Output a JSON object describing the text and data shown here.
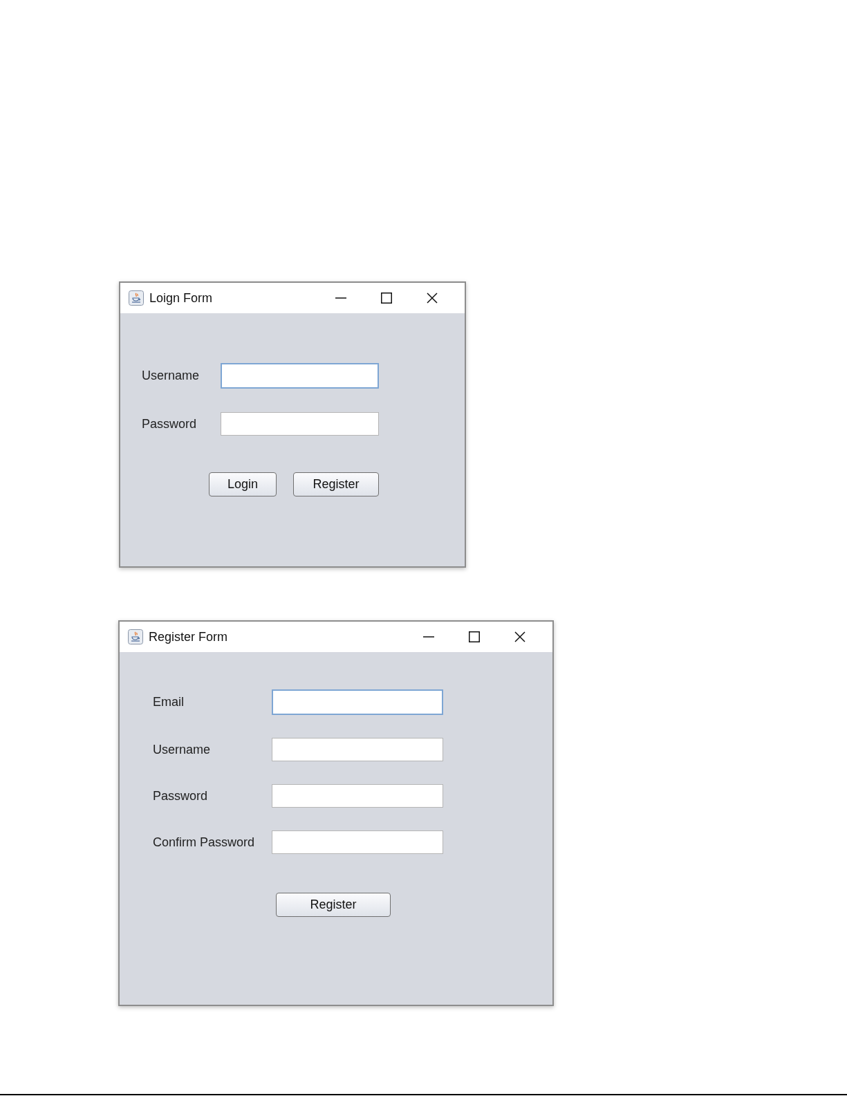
{
  "windows": [
    {
      "title": "Loign Form",
      "fields": [
        {
          "label": "Username",
          "focused": true
        },
        {
          "label": "Password",
          "focused": false
        }
      ],
      "buttons": [
        "Login",
        "Register"
      ]
    },
    {
      "title": "Register Form",
      "fields": [
        {
          "label": "Email",
          "focused": true
        },
        {
          "label": "Username",
          "focused": false
        },
        {
          "label": "Password",
          "focused": false
        },
        {
          "label": "Confirm Password",
          "focused": false
        }
      ],
      "buttons": [
        "Register"
      ]
    }
  ]
}
